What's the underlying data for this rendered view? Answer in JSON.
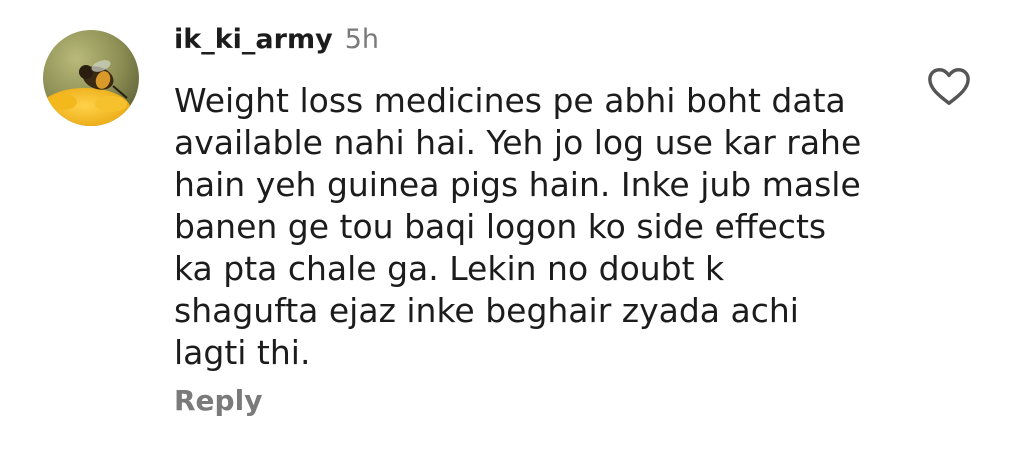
{
  "comment": {
    "avatar_icon": "bee-on-flower-avatar",
    "username": "ik_ki_army",
    "time": "5h",
    "text": "Weight loss medicines pe abhi boht data\navailable nahi hai. Yeh jo log use kar rahe\nhain yeh guinea pigs hain. Inke jub masle\nbanen ge tou baqi logon ko side effects\nka pta chale ga. Lekin no doubt k\nshagufta ejaz inke beghair zyada achi\nlagti thi.",
    "reply_label": "Reply",
    "like_icon": "heart-outline-icon"
  },
  "colors": {
    "text": "#1c1c1c",
    "muted": "#7a7a7a",
    "background": "#ffffff"
  }
}
